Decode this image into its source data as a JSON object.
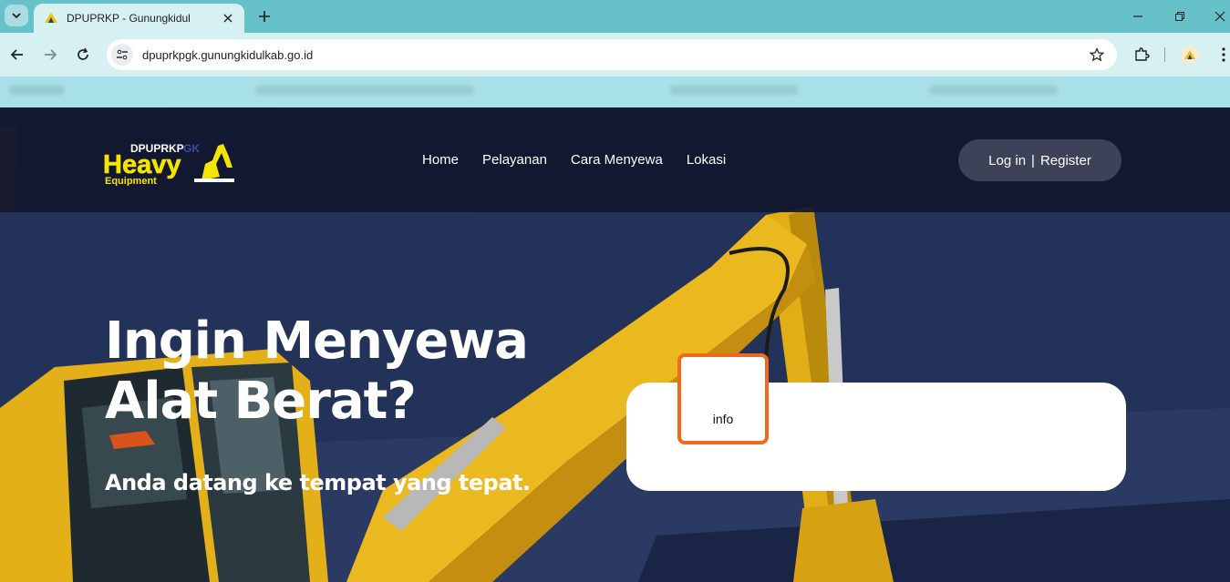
{
  "browser": {
    "tab_title": "DPUPRKP - Gunungkidul",
    "url": "dpuprkpgk.gunungkidulkab.go.id"
  },
  "site": {
    "logo": {
      "line1": "DPUPRKP",
      "suffix": "GK",
      "line2": "Heavy",
      "line3": "Equipment"
    },
    "nav": [
      "Home",
      "Pelayanan",
      "Cara Menyewa",
      "Lokasi"
    ],
    "auth": {
      "login": "Log in",
      "separator": "|",
      "register": "Register"
    },
    "hero": {
      "title_line1": "Ingin Menyewa",
      "title_line2": "Alat Berat?",
      "subtitle": "Anda datang ke tempat yang tepat."
    },
    "info_label": "info"
  },
  "colors": {
    "header_bg": "#10162c",
    "hero_bg": "#233259",
    "accent_orange": "#ef6a1c",
    "excavator_yellow": "#e9b91f",
    "tab_bar": "#66c1c8"
  }
}
